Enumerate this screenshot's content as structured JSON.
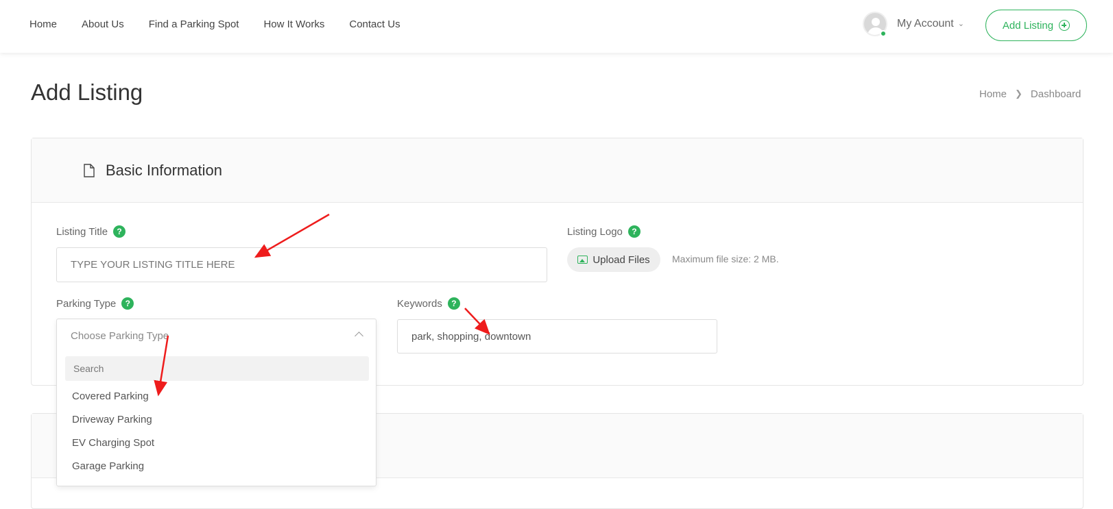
{
  "nav": {
    "items": [
      "Home",
      "About Us",
      "Find a Parking Spot",
      "How It Works",
      "Contact Us"
    ]
  },
  "account": {
    "label": "My Account"
  },
  "header_button": {
    "label": "Add Listing"
  },
  "page": {
    "title": "Add Listing"
  },
  "breadcrumb": {
    "home": "Home",
    "current": "Dashboard"
  },
  "basic_info": {
    "title": "Basic Information",
    "listing_title": {
      "label": "Listing Title",
      "placeholder": "TYPE YOUR LISTING TITLE HERE"
    },
    "listing_logo": {
      "label": "Listing Logo",
      "upload_label": "Upload Files",
      "max_size": "Maximum file size: 2 MB."
    },
    "parking_type": {
      "label": "Parking Type",
      "selected": "Choose Parking Type",
      "search_placeholder": "Search",
      "options": [
        "Covered Parking",
        "Driveway Parking",
        "EV Charging Spot",
        "Garage Parking"
      ]
    },
    "keywords": {
      "label": "Keywords",
      "value": "park, shopping, downtown"
    }
  },
  "help_glyph": "?",
  "colors": {
    "accent": "#2eb35c",
    "annotation": "#ee1c1c"
  }
}
